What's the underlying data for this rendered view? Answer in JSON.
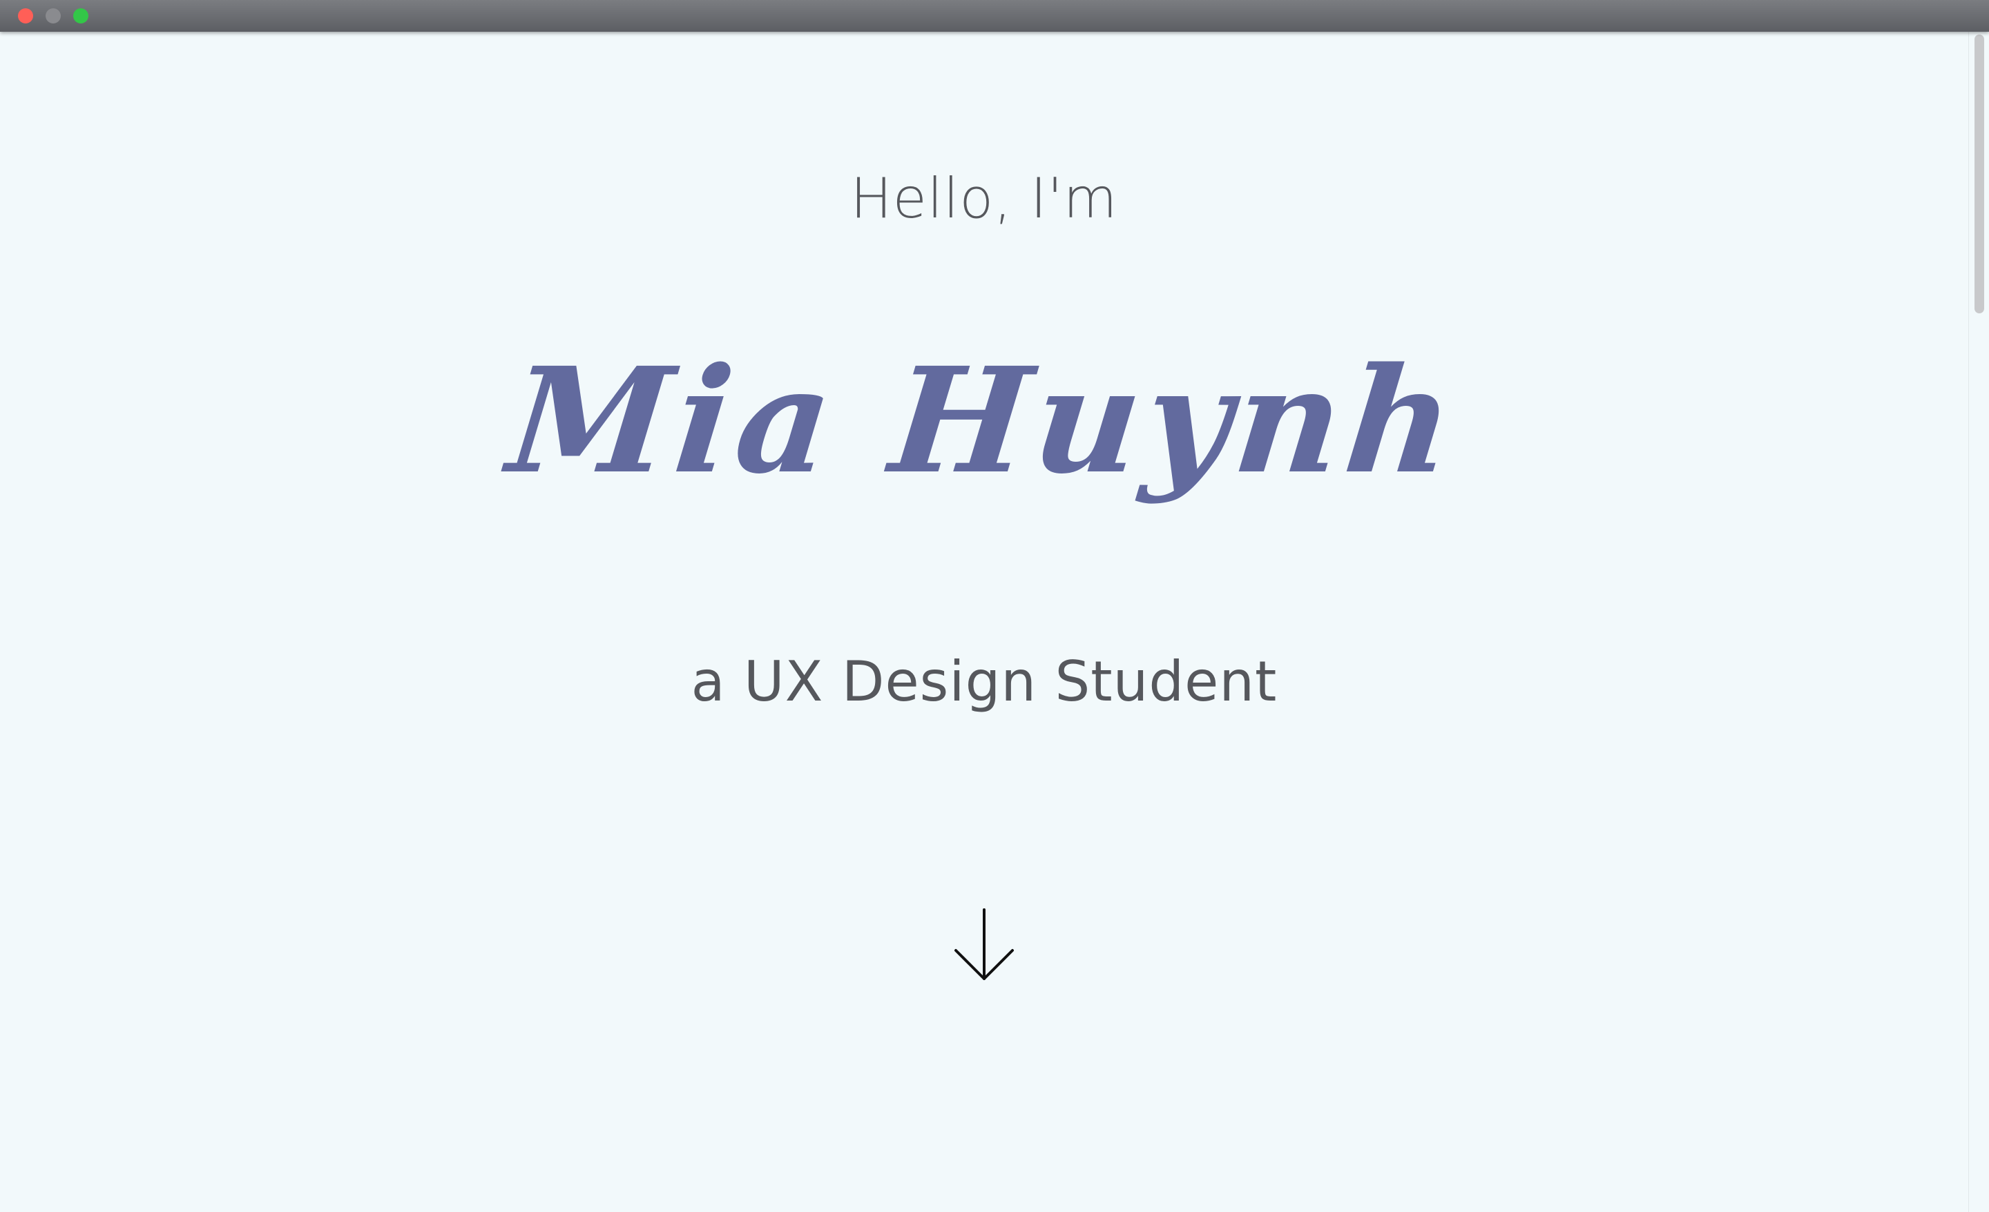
{
  "hero": {
    "greeting": "Hello, I'm",
    "name": "Mia Huynh",
    "role": "a UX Design Student"
  },
  "icons": {
    "scroll_down": "arrow-down-icon"
  },
  "colors": {
    "background": "#f2f9fb",
    "name_accent": "#626a9e",
    "text": "#56585d",
    "close": "#ff5f57",
    "minimize": "#8a8b8f",
    "maximize": "#33c748"
  }
}
